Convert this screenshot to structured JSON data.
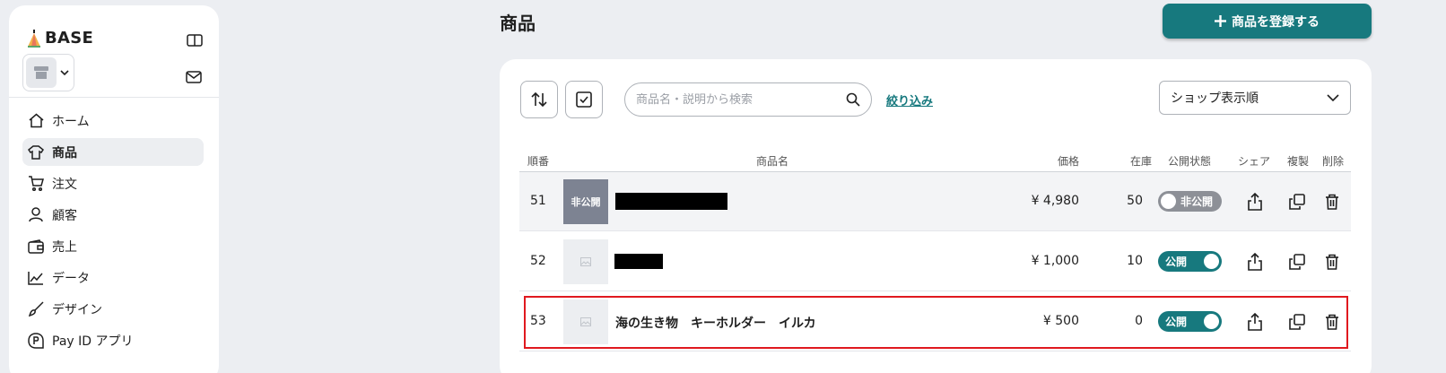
{
  "sidebar": {
    "brand": "BASE",
    "nav": [
      {
        "label": "ホーム",
        "icon": "home-icon",
        "active": false
      },
      {
        "label": "商品",
        "icon": "shirt-icon",
        "active": true
      },
      {
        "label": "注文",
        "icon": "cart-icon",
        "active": false
      },
      {
        "label": "顧客",
        "icon": "person-icon",
        "active": false
      },
      {
        "label": "売上",
        "icon": "wallet-icon",
        "active": false
      },
      {
        "label": "データ",
        "icon": "chart-icon",
        "active": false
      },
      {
        "label": "デザイン",
        "icon": "brush-icon",
        "active": false
      },
      {
        "label": "Pay ID アプリ",
        "icon": "payid-icon",
        "active": false
      }
    ]
  },
  "header": {
    "title": "商品",
    "add_button": "商品を登録する"
  },
  "toolbar": {
    "search_placeholder": "商品名・説明から検索",
    "filter_link": "絞り込み",
    "sort_value": "ショップ表示順"
  },
  "table": {
    "columns": {
      "order": "順番",
      "name": "商品名",
      "price": "価格",
      "stock": "在庫",
      "status": "公開状態",
      "share": "シェア",
      "copy": "複製",
      "delete": "削除"
    },
    "rows": [
      {
        "order": "51",
        "name": "",
        "name_redacted": true,
        "thumb_label": "非公開",
        "price": "¥ 4,980",
        "stock": "50",
        "status": "非公開",
        "published": false
      },
      {
        "order": "52",
        "name": "",
        "name_redacted": true,
        "thumb_label": "",
        "price": "¥ 1,000",
        "stock": "10",
        "status": "公開",
        "published": true
      },
      {
        "order": "53",
        "name": "海の生き物　キーホルダー　イルカ",
        "name_redacted": false,
        "thumb_label": "",
        "price": "¥ 500",
        "stock": "0",
        "status": "公開",
        "published": true
      }
    ]
  },
  "colors": {
    "accent": "#17797e",
    "highlight": "#e0191f",
    "background": "#eceef2"
  }
}
